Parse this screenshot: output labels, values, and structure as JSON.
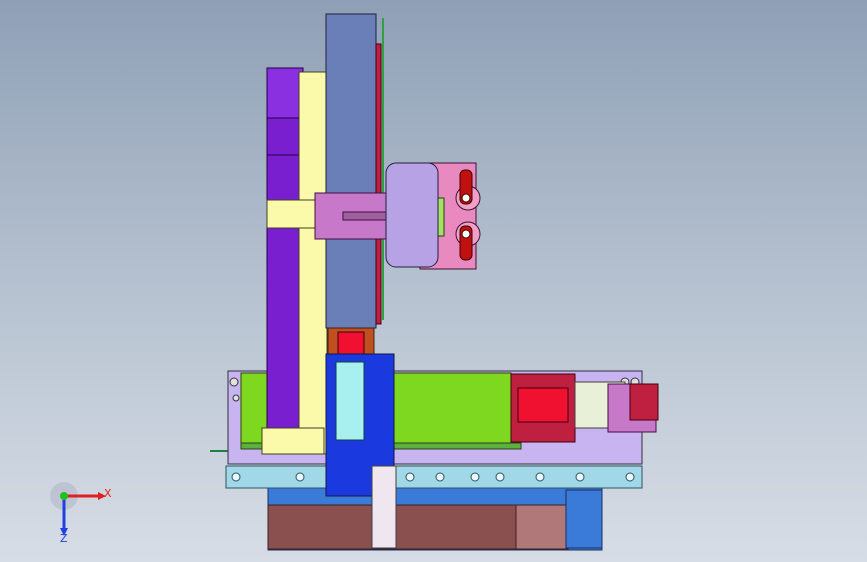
{
  "viewport": {
    "background_top": "#8fa0b6",
    "background_bottom": "#d7dde6"
  },
  "triad": {
    "x_label": "X",
    "z_label": "Z",
    "x_color": "#e02020",
    "y_color": "#20c020",
    "z_color": "#2040e0"
  },
  "colors": {
    "purple_column": "#7a1fd0",
    "pale_yellow": "#fbfaaa",
    "slate_blue": "#6a7eb8",
    "lavender": "#b8a2e6",
    "pink": "#e889c0",
    "magenta_plate": "#c878c8",
    "lime_green": "#7ed820",
    "royal_blue": "#1a3ae0",
    "cyan": "#a8f0f0",
    "light_blue_rail": "#a0d8e8",
    "lilac_base": "#c8b4f0",
    "brown_base": "#8a5050",
    "steel_blue": "#3a7ad8",
    "crimson": "#c02040",
    "red": "#f01030",
    "orange_brown": "#c05020",
    "white_bracket": "#f0e6f0"
  }
}
